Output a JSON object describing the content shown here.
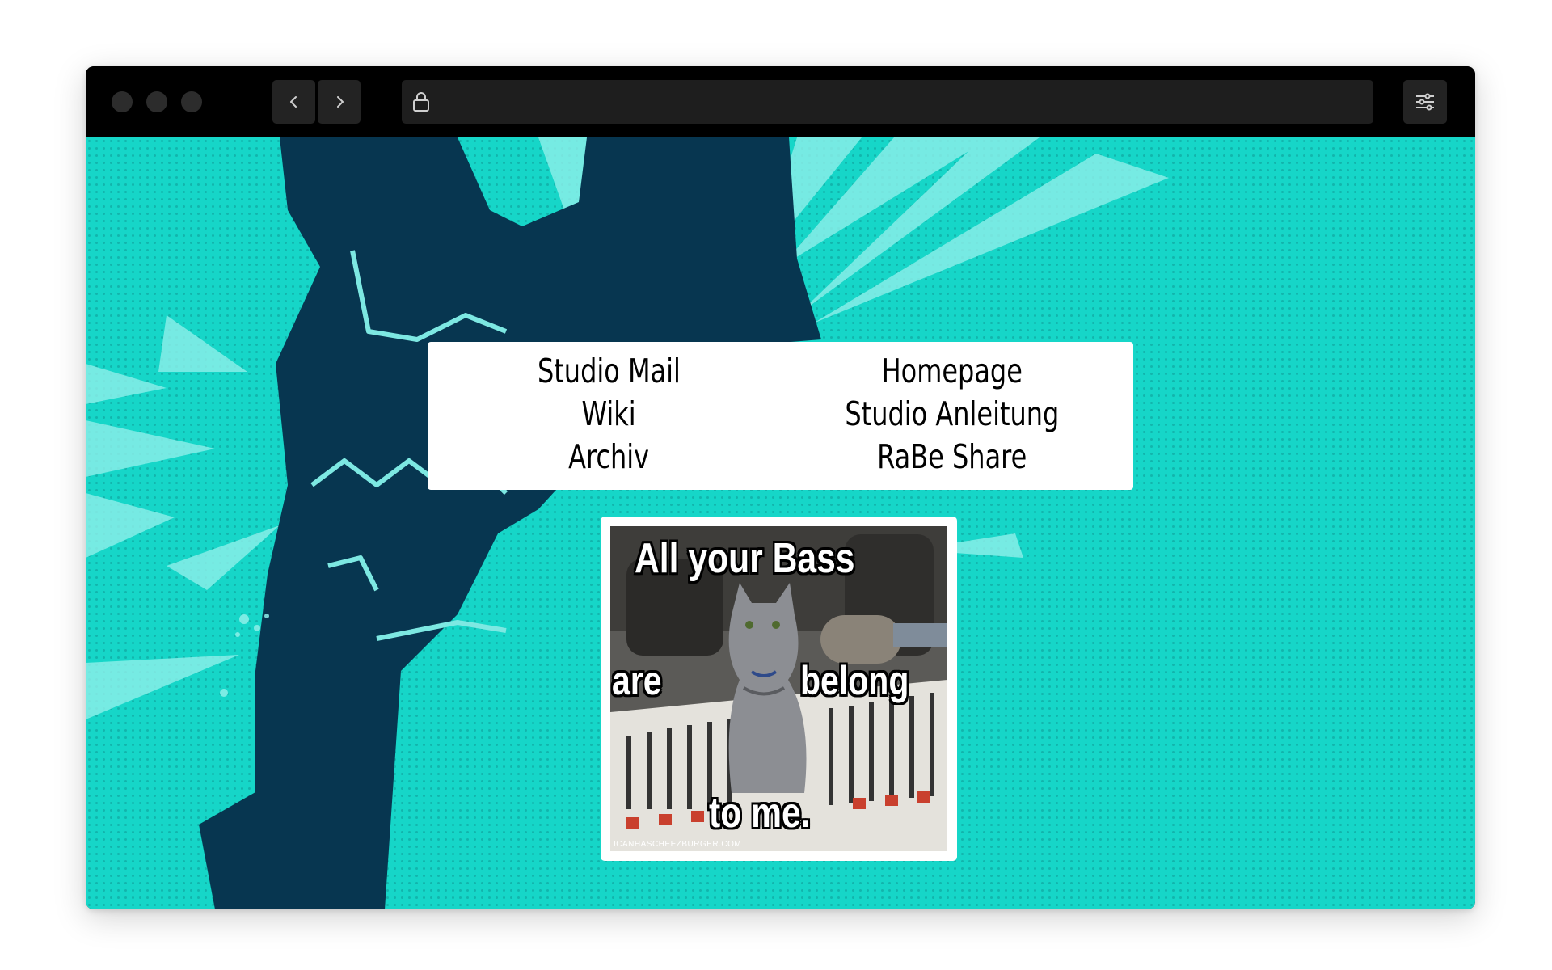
{
  "browser": {
    "back_icon": "chevron-left-icon",
    "forward_icon": "chevron-right-icon",
    "lock_icon": "lock-icon",
    "settings_icon": "sliders-icon",
    "url": ""
  },
  "links": {
    "left": [
      "Studio Mail",
      "Wiki",
      "Archiv"
    ],
    "right": [
      "Homepage",
      "Studio Anleitung",
      "RaBe Share"
    ]
  },
  "meme": {
    "line1": "All your Bass",
    "line2a": "are",
    "line2b": "belong",
    "line3": "to me.",
    "watermark": "ICANHASCHEEZBURGER.COM"
  },
  "colors": {
    "background": "#16d6c8",
    "fist": "#073650",
    "rays": "#8ef0ea"
  }
}
